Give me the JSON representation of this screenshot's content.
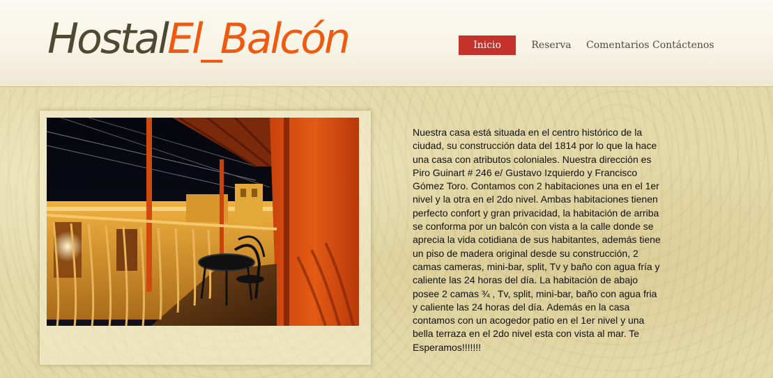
{
  "logo": {
    "part1": "Hostal",
    "part2": "El_Balcón"
  },
  "nav": {
    "items": [
      {
        "label": "Inicio",
        "active": true
      },
      {
        "label": "Reserva",
        "active": false
      },
      {
        "label": "Comentarios",
        "active": false
      },
      {
        "label": "Contáctenos",
        "active": false
      }
    ]
  },
  "content": {
    "description": "Nuestra casa está situada en el centro histórico de la ciudad, su construcción data del 1814 por lo que la hace una casa con atributos coloniales. Nuestra dirección es Piro Guinart # 246 e/ Gustavo Izquierdo y Francisco Gómez Toro. Contamos con 2 habitaciones una en el 1er nivel y la otra en el 2do nivel. Ambas habitaciones tienen perfecto confort y gran privacidad, la habitación de arriba se conforma por un balcón con vista a la calle donde se aprecia la vida cotidiana de sus habitantes, además tiene un piso de madera original desde su construcción, 2 camas cameras, mini-bar, split, Tv y baño con agua fría y caliente las 24 horas del día. La habitación de abajo posee 2 camas ¾ , Tv, split, mini-bar, baño con agua fria y caliente las 24 horas del día. Además en la casa contamos con un acogedor patio en el 1er nivel y una bella terraza en el 2do nivel esta con vista al mar. Te Esperamos!!!!!!!"
  },
  "colors": {
    "logo_dark": "#4c4a33",
    "logo_accent": "#f05a10",
    "nav_active_bg": "#c5322b",
    "nav_text": "#4e4a35"
  }
}
